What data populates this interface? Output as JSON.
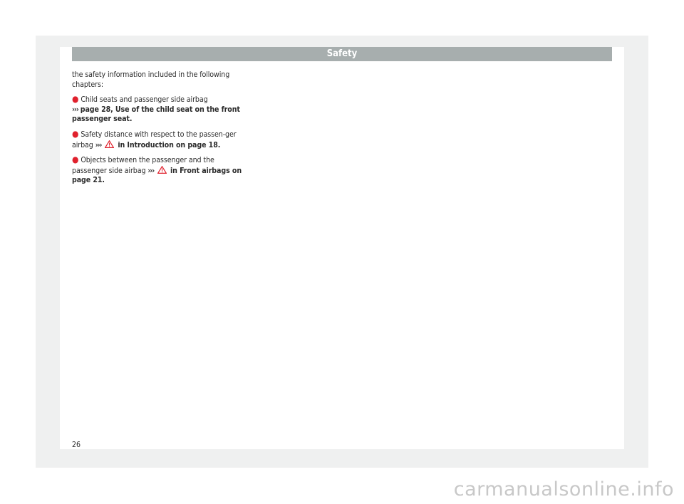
{
  "header": {
    "title": "Safety"
  },
  "intro": "the safety information included in the following chapters:",
  "items": [
    {
      "prefix": "Child seats and passenger side airbag",
      "arrows": "›››",
      "ref": "page 28, Use of the child seat on the front passenger seat."
    },
    {
      "prefix": "Safety distance with respect to the passen-ger airbag",
      "arrows": "›››",
      "ref": "in Introduction on page 18."
    },
    {
      "prefix": "Objects between the passenger and the passenger side airbag",
      "arrows": "›››",
      "ref": "in Front airbags on page 21."
    }
  ],
  "page_number": "26",
  "watermark": "carmanualsonline.info",
  "colors": {
    "header_bg": "#a7aeae",
    "bullet": "#e0212d",
    "warning": "#e0212d",
    "frame": "#eff0f0"
  }
}
